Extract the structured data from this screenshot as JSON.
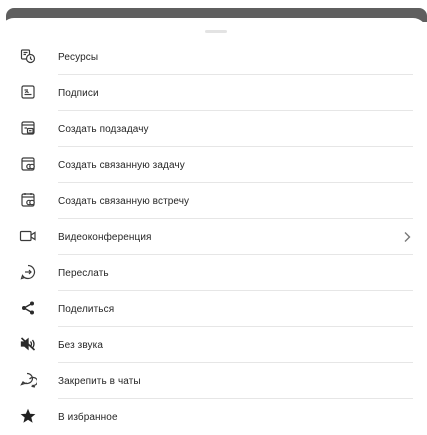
{
  "menu": {
    "items": [
      {
        "label": "Ресурсы",
        "icon": "resources-icon"
      },
      {
        "label": "Подписи",
        "icon": "signature-icon"
      },
      {
        "label": "Создать подзадачу",
        "icon": "subtask-icon"
      },
      {
        "label": "Создать связанную задачу",
        "icon": "linked-task-icon"
      },
      {
        "label": "Создать связанную встречу",
        "icon": "linked-meeting-icon"
      },
      {
        "label": "Видеоконференция",
        "icon": "video-camera-icon",
        "has_chevron": true
      },
      {
        "label": "Переслать",
        "icon": "forward-icon"
      },
      {
        "label": "Поделиться",
        "icon": "share-icon"
      },
      {
        "label": "Без звука",
        "icon": "mute-icon"
      },
      {
        "label": "Закрепить в чаты",
        "icon": "pin-chat-icon"
      },
      {
        "label": "В избранное",
        "icon": "star-icon"
      }
    ]
  },
  "colors": {
    "text": "#262626",
    "icon": "#3a3a3a",
    "divider": "#e6e6e6",
    "backdrop_bar": "#5f5f5f"
  }
}
